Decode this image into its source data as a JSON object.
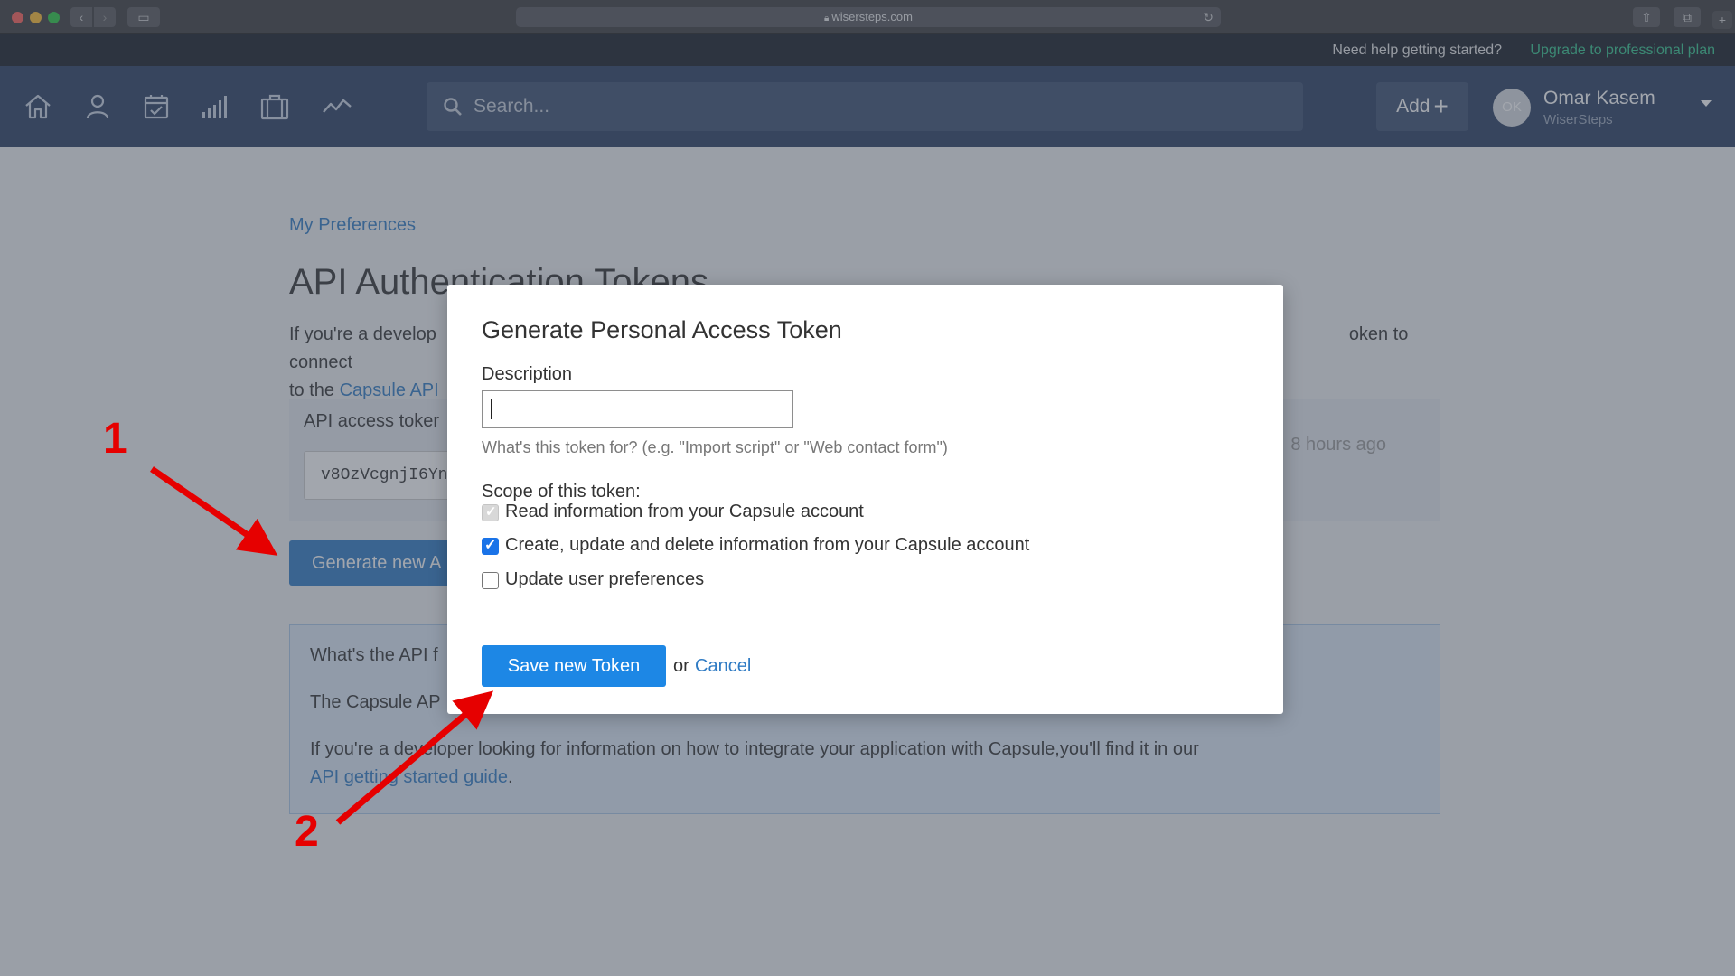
{
  "browser": {
    "url": "wisersteps.com"
  },
  "helpbar": {
    "help_text": "Need help getting started?",
    "upgrade_link": "Upgrade to professional plan"
  },
  "navbar": {
    "icons": [
      "home-icon",
      "person-icon",
      "calendar-icon",
      "bar-chart-icon",
      "briefcase-icon",
      "trend-line-icon"
    ],
    "search_placeholder": "Search...",
    "add_label": "Add",
    "user": {
      "initials": "OK",
      "name": "Omar Kasem",
      "org": "WiserSteps"
    }
  },
  "page": {
    "breadcrumb": "My Preferences",
    "title": "API Authentication Tokens",
    "intro_start": "If you're a develop",
    "intro_end": "oken to connect",
    "intro_line2_prefix": "to the ",
    "capsule_api_link": "Capsule API",
    "token_panel": {
      "label": "API access toker",
      "token_value": "v8OzVcgnjI6Yn",
      "time": "8 hours ago"
    },
    "generate_button": "Generate new A",
    "info": {
      "heading": "What's the API f",
      "line2": "The Capsule AP",
      "line3": "If you're a developer looking for information on how to integrate your application with Capsule,you'll find it in our",
      "guide_link": "API getting started guide",
      "guide_suffix": "."
    }
  },
  "modal": {
    "title": "Generate Personal Access Token",
    "description_label": "Description",
    "description_value": "",
    "description_help": "What's this token for? (e.g. \"Import script\" or \"Web contact form\")",
    "scope_label": "Scope of this token:",
    "scopes": [
      {
        "label": "Read information from your Capsule account",
        "checked": true,
        "disabled": true
      },
      {
        "label": "Create, update and delete information from your Capsule account",
        "checked": true,
        "disabled": false
      },
      {
        "label": "Update user preferences",
        "checked": false,
        "disabled": false
      }
    ],
    "save_button": "Save new Token",
    "or_text": "or",
    "cancel_link": "Cancel"
  },
  "annotations": {
    "step1": "1",
    "step2": "2"
  },
  "colors": {
    "navbar": "#283d61",
    "primary": "#1d87e5",
    "link": "#2f7bc4",
    "upgrade": "#32c58d",
    "annotation": "#e60000"
  }
}
